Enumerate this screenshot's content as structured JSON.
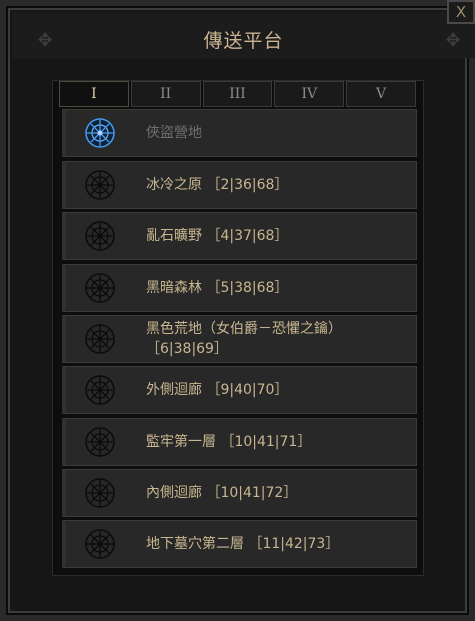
{
  "window": {
    "title": "傳送平台",
    "close_label": "X"
  },
  "tabs": [
    {
      "label": "I",
      "active": true
    },
    {
      "label": "II",
      "active": false
    },
    {
      "label": "III",
      "active": false
    },
    {
      "label": "IV",
      "active": false
    },
    {
      "label": "V",
      "active": false
    }
  ],
  "waypoints": [
    {
      "label": "俠盜營地",
      "state": "current",
      "icon": "waypoint-icon-active"
    },
    {
      "label": "冰冷之原 ［2|36|68］",
      "state": "available",
      "icon": "waypoint-icon"
    },
    {
      "label": "亂石曠野 ［4|37|68］",
      "state": "available",
      "icon": "waypoint-icon"
    },
    {
      "label": "黑暗森林 ［5|38|68］",
      "state": "available",
      "icon": "waypoint-icon"
    },
    {
      "label": "黑色荒地（女伯爵－恐懼之鑰）",
      "label_line2": "［6|38|69］",
      "state": "available",
      "icon": "waypoint-icon"
    },
    {
      "label": "外側迴廊 ［9|40|70］",
      "state": "available",
      "icon": "waypoint-icon"
    },
    {
      "label": "監牢第一層 ［10|41|71］",
      "state": "available",
      "icon": "waypoint-icon"
    },
    {
      "label": "內側迴廊 ［10|41|72］",
      "state": "available",
      "icon": "waypoint-icon"
    },
    {
      "label": "地下墓穴第二層 ［11|42|73］",
      "state": "available",
      "icon": "waypoint-icon"
    }
  ],
  "colors": {
    "label": "#c8b690",
    "label_disabled": "#6f6f6f",
    "active_icon": "#3f8fe0",
    "title": "#c9b591"
  }
}
